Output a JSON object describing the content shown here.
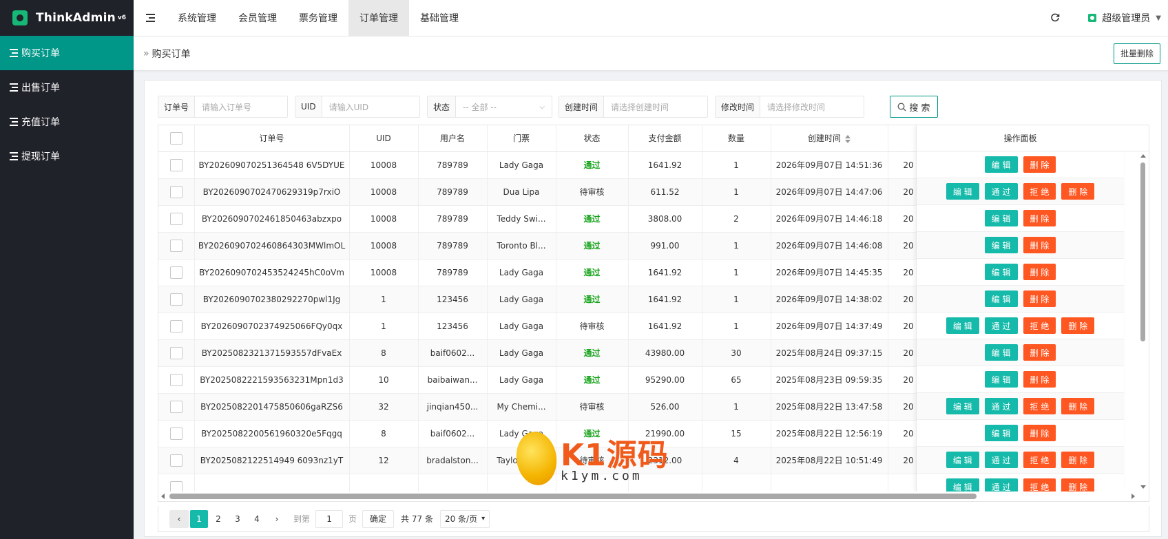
{
  "app": {
    "name": "ThinkAdmin",
    "version": "v6"
  },
  "sidebar": {
    "items": [
      {
        "label": "购买订单",
        "icon": "list-icon",
        "active": true
      },
      {
        "label": "出售订单",
        "icon": "list-icon",
        "active": false
      },
      {
        "label": "充值订单",
        "icon": "list-icon",
        "active": false
      },
      {
        "label": "提现订单",
        "icon": "list-icon",
        "active": false
      }
    ]
  },
  "header": {
    "tabs": [
      {
        "label": "系统管理",
        "active": false
      },
      {
        "label": "会员管理",
        "active": false
      },
      {
        "label": "票务管理",
        "active": false
      },
      {
        "label": "订单管理",
        "active": true
      },
      {
        "label": "基础管理",
        "active": false
      }
    ],
    "user": "超级管理员"
  },
  "breadcrumb": {
    "title": "购买订单",
    "batch_delete": "批量删除"
  },
  "filters": {
    "order_no": {
      "label": "订单号",
      "placeholder": "请输入订单号"
    },
    "uid": {
      "label": "UID",
      "placeholder": "请输入UID"
    },
    "status": {
      "label": "状态",
      "value": "-- 全部 --"
    },
    "created": {
      "label": "创建时间",
      "placeholder": "请选择创建时间"
    },
    "modified": {
      "label": "修改时间",
      "placeholder": "请选择修改时间"
    },
    "search_button": "搜 索"
  },
  "table": {
    "columns": [
      "订单号",
      "UID",
      "用户名",
      "门票",
      "状态",
      "支付金额",
      "数量",
      "创建时间"
    ],
    "ops_header": "操作面板",
    "rows": [
      {
        "order": "BY202609070251364548 6V5DYUE",
        "uid": "10008",
        "user": "789789",
        "ticket": "Lady Gaga",
        "status": "通过",
        "amount": "1641.92",
        "qty": "1",
        "created": "2026年09月07日 14:51:36",
        "extra": "20",
        "actions": [
          "编 辑",
          "删 除"
        ]
      },
      {
        "order": "BY2026090702470629319p7rxiO",
        "uid": "10008",
        "user": "789789",
        "ticket": "Dua Lipa",
        "status": "待审核",
        "amount": "611.52",
        "qty": "1",
        "created": "2026年09月07日 14:47:06",
        "extra": "20",
        "actions": [
          "编 辑",
          "通 过",
          "拒 绝",
          "删 除"
        ]
      },
      {
        "order": "BY2026090702461850463abzxpo",
        "uid": "10008",
        "user": "789789",
        "ticket": "Teddy Swi...",
        "status": "通过",
        "amount": "3808.00",
        "qty": "2",
        "created": "2026年09月07日 14:46:18",
        "extra": "20",
        "actions": [
          "编 辑",
          "删 除"
        ]
      },
      {
        "order": "BY2026090702460864303MWlmOL",
        "uid": "10008",
        "user": "789789",
        "ticket": "Toronto Bl...",
        "status": "通过",
        "amount": "991.00",
        "qty": "1",
        "created": "2026年09月07日 14:46:08",
        "extra": "20",
        "actions": [
          "编 辑",
          "删 除"
        ]
      },
      {
        "order": "BY2026090702453524245hC0oVm",
        "uid": "10008",
        "user": "789789",
        "ticket": "Lady Gaga",
        "status": "通过",
        "amount": "1641.92",
        "qty": "1",
        "created": "2026年09月07日 14:45:35",
        "extra": "20",
        "actions": [
          "编 辑",
          "删 除"
        ]
      },
      {
        "order": "BY2026090702380292270pwl1Jg",
        "uid": "1",
        "user": "123456",
        "ticket": "Lady Gaga",
        "status": "通过",
        "amount": "1641.92",
        "qty": "1",
        "created": "2026年09月07日 14:38:02",
        "extra": "20",
        "actions": [
          "编 辑",
          "删 除"
        ]
      },
      {
        "order": "BY2026090702374925066FQy0qx",
        "uid": "1",
        "user": "123456",
        "ticket": "Lady Gaga",
        "status": "待审核",
        "amount": "1641.92",
        "qty": "1",
        "created": "2026年09月07日 14:37:49",
        "extra": "20",
        "actions": [
          "编 辑",
          "通 过",
          "拒 绝",
          "删 除"
        ]
      },
      {
        "order": "BY2025082321371593557dFvaEx",
        "uid": "8",
        "user": "baif0602...",
        "ticket": "Lady Gaga",
        "status": "通过",
        "amount": "43980.00",
        "qty": "30",
        "created": "2025年08月24日 09:37:15",
        "extra": "20",
        "actions": [
          "编 辑",
          "删 除"
        ]
      },
      {
        "order": "BY2025082221593563231Mpn1d3",
        "uid": "10",
        "user": "baibaiwan...",
        "ticket": "Lady Gaga",
        "status": "通过",
        "amount": "95290.00",
        "qty": "65",
        "created": "2025年08月23日 09:59:35",
        "extra": "20",
        "actions": [
          "编 辑",
          "删 除"
        ]
      },
      {
        "order": "BY2025082201475850606gaRZS6",
        "uid": "32",
        "user": "jinqian450...",
        "ticket": "My Chemi...",
        "status": "待审核",
        "amount": "526.00",
        "qty": "1",
        "created": "2025年08月22日 13:47:58",
        "extra": "20",
        "actions": [
          "编 辑",
          "通 过",
          "拒 绝",
          "删 除"
        ]
      },
      {
        "order": "BY2025082200561960320e5Fqgq",
        "uid": "8",
        "user": "baif0602...",
        "ticket": "Lady Gaga",
        "status": "通过",
        "amount": "21990.00",
        "qty": "15",
        "created": "2025年08月22日 12:56:19",
        "extra": "20",
        "actions": [
          "编 辑",
          "删 除"
        ]
      },
      {
        "order": "BY2025082122514949 6093nz1yT",
        "uid": "12",
        "user": "bradalston...",
        "ticket": "Taylor Swi...",
        "status": "待审核",
        "amount": "2312.00",
        "qty": "4",
        "created": "2025年08月22日 10:51:49",
        "extra": "20",
        "actions": [
          "编 辑",
          "通 过",
          "拒 绝",
          "删 除"
        ]
      },
      {
        "order": "",
        "uid": "",
        "user": "",
        "ticket": "",
        "status": "",
        "amount": "",
        "qty": "",
        "created": "",
        "extra": "",
        "actions": [
          "编 辑",
          "通 过",
          "拒 绝",
          "删 除"
        ]
      }
    ]
  },
  "pagination": {
    "pages": [
      "1",
      "2",
      "3",
      "4"
    ],
    "current": "1",
    "goto_label": "到第",
    "goto_value": "1",
    "page_unit": "页",
    "confirm": "确定",
    "total": "共 77 条",
    "page_size": "20 条/页"
  },
  "watermark": {
    "title": "K1源码",
    "url": "k1ym.com"
  },
  "colors": {
    "sidebar_bg": "#20222a",
    "accent": "#009688",
    "teal_button": "#16baaa",
    "orange_button": "#ff5722",
    "pass_status": "#16a31a"
  }
}
